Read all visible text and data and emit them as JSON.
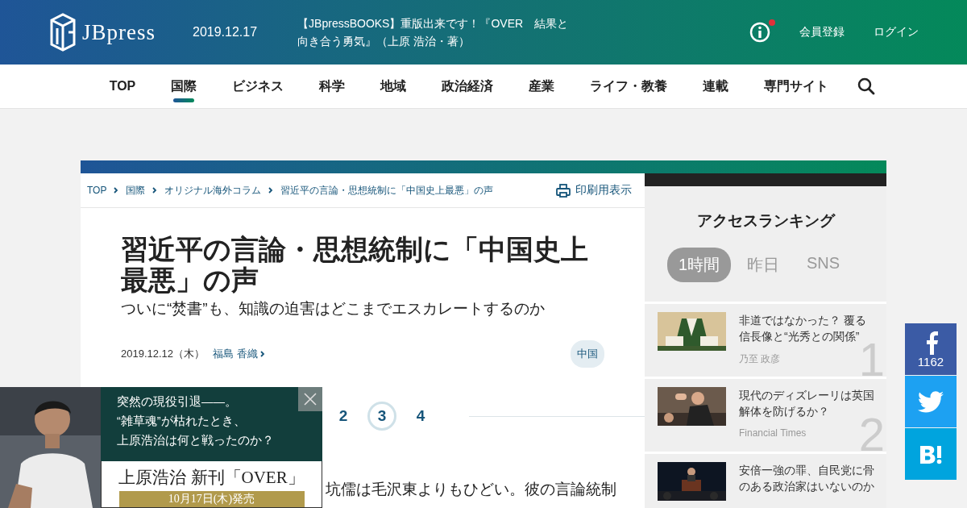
{
  "header": {
    "logo": "JBpress",
    "date": "2019.12.17",
    "notice": "【JBpressBOOKS】重版出来です！『OVER　結果と向き合う勇気』（上原 浩治・著）",
    "has_notification": true,
    "links": [
      "会員登録",
      "ログイン"
    ]
  },
  "nav": [
    {
      "label": "TOP",
      "selected": false
    },
    {
      "label": "国際",
      "selected": true
    },
    {
      "label": "ビジネス",
      "selected": false
    },
    {
      "label": "科学",
      "selected": false
    },
    {
      "label": "地域",
      "selected": false
    },
    {
      "label": "政治経済",
      "selected": false
    },
    {
      "label": "産業",
      "selected": false
    },
    {
      "label": "ライフ・教養",
      "selected": false
    },
    {
      "label": "連載",
      "selected": false
    },
    {
      "label": "専門サイト",
      "selected": false
    }
  ],
  "breadcrumb": [
    "TOP",
    "国際",
    "オリジナル海外コラム",
    "習近平の言論・思想統制に「中国史上最悪」の声"
  ],
  "print_link": "印刷用表示",
  "article": {
    "title": "習近平の言論・思想統制に「中国史上最悪」の声",
    "subtitle": "ついに“焚書”も、知識の迫害はどこまでエスカレートするのか",
    "date": "2019.12.12（木）",
    "author": "福島 香織",
    "tag": "中国",
    "pages": [
      {
        "label": "2",
        "selected": false
      },
      {
        "label": "3",
        "selected": true
      },
      {
        "label": "4",
        "selected": false
      }
    ],
    "body": "坑儒は毛沢東よりもひどい。彼の言論統制"
  },
  "ranking": {
    "title": "アクセスランキング",
    "tabs": [
      {
        "label": "1時間",
        "selected": true
      },
      {
        "label": "昨日",
        "selected": false
      },
      {
        "label": "SNS",
        "selected": false
      }
    ],
    "items": [
      {
        "title": "非道ではなかった？ 覆る信長像と“光秀との関係”",
        "author": "乃至 政彦",
        "rank": "1",
        "kind": "picture"
      },
      {
        "title": "現代のディズレーリは英国解体を防げるか？",
        "author": "Financial Times",
        "rank": "2",
        "kind": "picture"
      },
      {
        "title": "安倍一強の罪、自民党に骨のある政治家はいないのか",
        "kind": "picture"
      }
    ]
  },
  "social": {
    "facebook_count": "1162"
  },
  "ad": {
    "lines": [
      "突然の現役引退――。",
      "“雑草魂”が枯れたとき、",
      "上原浩治は何と戦ったのか？"
    ],
    "book": "上原浩治 新刊「OVER」",
    "release": "10月17日(木)発売"
  }
}
